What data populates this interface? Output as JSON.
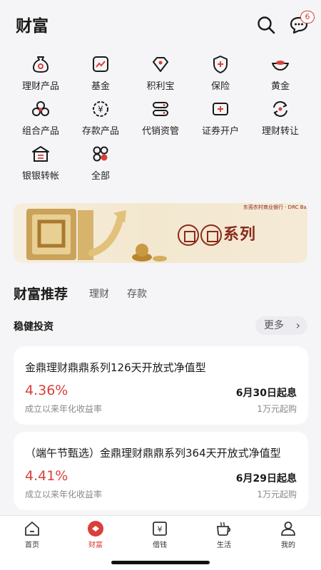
{
  "header": {
    "title": "财富",
    "message_badge": "6"
  },
  "grid": [
    {
      "label": "理财产品",
      "icon": "money-bag-icon"
    },
    {
      "label": "基金",
      "icon": "fund-chart-icon"
    },
    {
      "label": "积利宝",
      "icon": "diamond-icon"
    },
    {
      "label": "保险",
      "icon": "shield-icon"
    },
    {
      "label": "黄金",
      "icon": "gold-ingot-icon"
    },
    {
      "label": "组合产品",
      "icon": "cluster-icon"
    },
    {
      "label": "存款产品",
      "icon": "yuan-coin-icon"
    },
    {
      "label": "代销资管",
      "icon": "stack-icon"
    },
    {
      "label": "证券开户",
      "icon": "plus-card-icon"
    },
    {
      "label": "理财转让",
      "icon": "transfer-icon"
    },
    {
      "label": "银银转帐",
      "icon": "bank-transfer-icon"
    },
    {
      "label": "全部",
      "icon": "all-grid-icon"
    }
  ],
  "banner": {
    "text": "系列",
    "bank": "东莞农村商业银行 · DRC Bank"
  },
  "tabs": {
    "main": "财富推荐",
    "tab2": "理财",
    "tab3": "存款"
  },
  "section": {
    "title": "稳健投资",
    "more": "更多"
  },
  "products": [
    {
      "name": "金鼎理财鼎鼎系列126天开放式净值型",
      "rate": "4.36%",
      "rate_label": "成立以来年化收益率",
      "start": "6月30日起息",
      "min": "1万元起购"
    },
    {
      "name": "（端午节甄选）金鼎理财鼎鼎系列364天开放式净值型",
      "rate": "4.41%",
      "rate_label": "成立以来年化收益率",
      "start": "6月29日起息",
      "min": "1万元起购"
    }
  ],
  "nav": [
    {
      "label": "首页",
      "icon": "home-icon"
    },
    {
      "label": "财富",
      "icon": "wealth-icon"
    },
    {
      "label": "借钱",
      "icon": "loan-icon"
    },
    {
      "label": "生活",
      "icon": "cup-icon"
    },
    {
      "label": "我的",
      "icon": "user-icon"
    }
  ],
  "colors": {
    "accent": "#d9403a",
    "text": "#1a1a1a"
  }
}
